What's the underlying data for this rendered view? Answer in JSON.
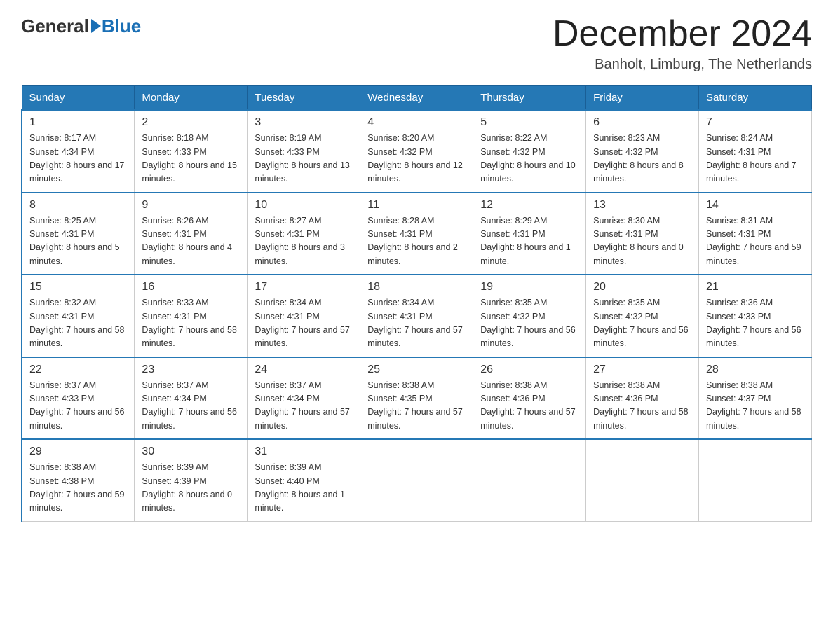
{
  "header": {
    "logo_general": "General",
    "logo_blue": "Blue",
    "month_year": "December 2024",
    "location": "Banholt, Limburg, The Netherlands"
  },
  "days_of_week": [
    "Sunday",
    "Monday",
    "Tuesday",
    "Wednesday",
    "Thursday",
    "Friday",
    "Saturday"
  ],
  "weeks": [
    [
      {
        "day": "1",
        "sunrise": "8:17 AM",
        "sunset": "4:34 PM",
        "daylight": "8 hours and 17 minutes."
      },
      {
        "day": "2",
        "sunrise": "8:18 AM",
        "sunset": "4:33 PM",
        "daylight": "8 hours and 15 minutes."
      },
      {
        "day": "3",
        "sunrise": "8:19 AM",
        "sunset": "4:33 PM",
        "daylight": "8 hours and 13 minutes."
      },
      {
        "day": "4",
        "sunrise": "8:20 AM",
        "sunset": "4:32 PM",
        "daylight": "8 hours and 12 minutes."
      },
      {
        "day": "5",
        "sunrise": "8:22 AM",
        "sunset": "4:32 PM",
        "daylight": "8 hours and 10 minutes."
      },
      {
        "day": "6",
        "sunrise": "8:23 AM",
        "sunset": "4:32 PM",
        "daylight": "8 hours and 8 minutes."
      },
      {
        "day": "7",
        "sunrise": "8:24 AM",
        "sunset": "4:31 PM",
        "daylight": "8 hours and 7 minutes."
      }
    ],
    [
      {
        "day": "8",
        "sunrise": "8:25 AM",
        "sunset": "4:31 PM",
        "daylight": "8 hours and 5 minutes."
      },
      {
        "day": "9",
        "sunrise": "8:26 AM",
        "sunset": "4:31 PM",
        "daylight": "8 hours and 4 minutes."
      },
      {
        "day": "10",
        "sunrise": "8:27 AM",
        "sunset": "4:31 PM",
        "daylight": "8 hours and 3 minutes."
      },
      {
        "day": "11",
        "sunrise": "8:28 AM",
        "sunset": "4:31 PM",
        "daylight": "8 hours and 2 minutes."
      },
      {
        "day": "12",
        "sunrise": "8:29 AM",
        "sunset": "4:31 PM",
        "daylight": "8 hours and 1 minute."
      },
      {
        "day": "13",
        "sunrise": "8:30 AM",
        "sunset": "4:31 PM",
        "daylight": "8 hours and 0 minutes."
      },
      {
        "day": "14",
        "sunrise": "8:31 AM",
        "sunset": "4:31 PM",
        "daylight": "7 hours and 59 minutes."
      }
    ],
    [
      {
        "day": "15",
        "sunrise": "8:32 AM",
        "sunset": "4:31 PM",
        "daylight": "7 hours and 58 minutes."
      },
      {
        "day": "16",
        "sunrise": "8:33 AM",
        "sunset": "4:31 PM",
        "daylight": "7 hours and 58 minutes."
      },
      {
        "day": "17",
        "sunrise": "8:34 AM",
        "sunset": "4:31 PM",
        "daylight": "7 hours and 57 minutes."
      },
      {
        "day": "18",
        "sunrise": "8:34 AM",
        "sunset": "4:31 PM",
        "daylight": "7 hours and 57 minutes."
      },
      {
        "day": "19",
        "sunrise": "8:35 AM",
        "sunset": "4:32 PM",
        "daylight": "7 hours and 56 minutes."
      },
      {
        "day": "20",
        "sunrise": "8:35 AM",
        "sunset": "4:32 PM",
        "daylight": "7 hours and 56 minutes."
      },
      {
        "day": "21",
        "sunrise": "8:36 AM",
        "sunset": "4:33 PM",
        "daylight": "7 hours and 56 minutes."
      }
    ],
    [
      {
        "day": "22",
        "sunrise": "8:37 AM",
        "sunset": "4:33 PM",
        "daylight": "7 hours and 56 minutes."
      },
      {
        "day": "23",
        "sunrise": "8:37 AM",
        "sunset": "4:34 PM",
        "daylight": "7 hours and 56 minutes."
      },
      {
        "day": "24",
        "sunrise": "8:37 AM",
        "sunset": "4:34 PM",
        "daylight": "7 hours and 57 minutes."
      },
      {
        "day": "25",
        "sunrise": "8:38 AM",
        "sunset": "4:35 PM",
        "daylight": "7 hours and 57 minutes."
      },
      {
        "day": "26",
        "sunrise": "8:38 AM",
        "sunset": "4:36 PM",
        "daylight": "7 hours and 57 minutes."
      },
      {
        "day": "27",
        "sunrise": "8:38 AM",
        "sunset": "4:36 PM",
        "daylight": "7 hours and 58 minutes."
      },
      {
        "day": "28",
        "sunrise": "8:38 AM",
        "sunset": "4:37 PM",
        "daylight": "7 hours and 58 minutes."
      }
    ],
    [
      {
        "day": "29",
        "sunrise": "8:38 AM",
        "sunset": "4:38 PM",
        "daylight": "7 hours and 59 minutes."
      },
      {
        "day": "30",
        "sunrise": "8:39 AM",
        "sunset": "4:39 PM",
        "daylight": "8 hours and 0 minutes."
      },
      {
        "day": "31",
        "sunrise": "8:39 AM",
        "sunset": "4:40 PM",
        "daylight": "8 hours and 1 minute."
      },
      null,
      null,
      null,
      null
    ]
  ]
}
